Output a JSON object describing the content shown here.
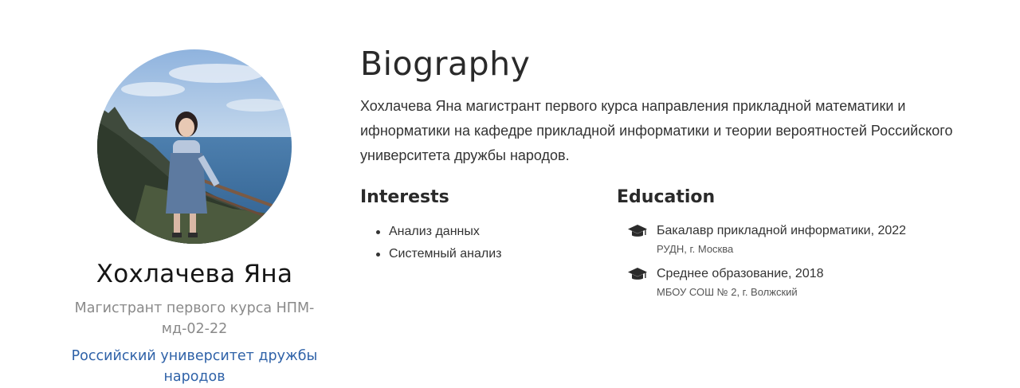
{
  "profile": {
    "name": "Хохлачева Яна",
    "role": "Магистрант первого курса НПМ-мд-02-22",
    "organization": "Российский университет дружбы народов"
  },
  "biography": {
    "heading": "Biography",
    "text": "Хохлачева Яна магистрант первого курса направления прикладной математики и ифнорматики на кафедре прикладной информатики и теории вероятностей Российского университета дружбы народов."
  },
  "interests": {
    "heading": "Interests",
    "items": [
      "Анализ данных",
      "Системный анализ"
    ]
  },
  "education": {
    "heading": "Education",
    "icon": "graduation-cap-icon",
    "items": [
      {
        "degree": "Бакалавр прикладной информатики, 2022",
        "institution": "РУДН, г. Москва"
      },
      {
        "degree": "Среднее образование, 2018",
        "institution": "МБОУ СОШ № 2, г. Волжский"
      }
    ]
  },
  "colors": {
    "link": "#2f62a8",
    "muted": "#8a8a8a",
    "text": "#333333"
  }
}
